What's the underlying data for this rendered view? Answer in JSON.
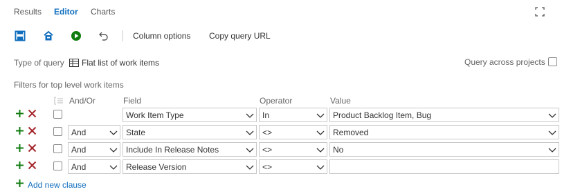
{
  "tabs": [
    {
      "label": "Results"
    },
    {
      "label": "Editor"
    },
    {
      "label": "Charts"
    }
  ],
  "toolbar": {
    "column_options": "Column options",
    "copy_query_url": "Copy query URL"
  },
  "query_type": {
    "label": "Type of query",
    "value": "Flat list of work items",
    "across_projects": "Query across projects"
  },
  "filters": {
    "title": "Filters for top level work items",
    "headers": {
      "andor": "And/Or",
      "field": "Field",
      "operator": "Operator",
      "value": "Value"
    },
    "rows": [
      {
        "andor": "",
        "field": "Work Item Type",
        "operator": "In",
        "value": "Product Backlog Item, Bug"
      },
      {
        "andor": "And",
        "field": "State",
        "operator": "<>",
        "value": "Removed"
      },
      {
        "andor": "And",
        "field": "Include In Release Notes",
        "operator": "<>",
        "value": "No"
      },
      {
        "andor": "And",
        "field": "Release Version",
        "operator": "<>",
        "value": ""
      }
    ],
    "add_clause": "Add new clause"
  },
  "colors": {
    "accent": "#106ebe",
    "add_green": "#107c10",
    "delete_red": "#a4262c"
  }
}
